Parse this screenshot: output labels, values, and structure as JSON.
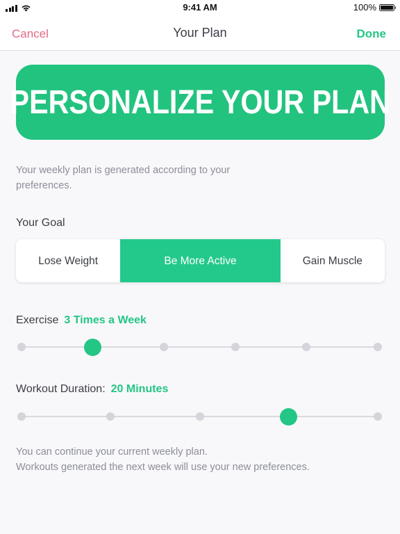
{
  "status_bar": {
    "time": "9:41 AM",
    "battery": "100%",
    "icons": [
      "signal-icon",
      "wifi-icon",
      "battery-icon"
    ]
  },
  "nav": {
    "cancel": "Cancel",
    "title": "Your Plan",
    "done": "Done"
  },
  "banner": {
    "text": "PERSONALIZE YOUR PLAN"
  },
  "intro": "Your weekly plan is generated according to your preferences.",
  "goal": {
    "label": "Your Goal",
    "options": [
      "Lose Weight",
      "Be More Active",
      "Gain Muscle"
    ],
    "selected_index": 1
  },
  "exercise": {
    "label": "Exercise",
    "value": "3 Times a Week",
    "stops": 6,
    "selected_index": 1
  },
  "duration": {
    "label": "Workout Duration:",
    "value": "20 Minutes",
    "stops": 5,
    "selected_index": 3
  },
  "footer": {
    "line1": "You can continue your current weekly plan.",
    "line2": "Workouts generated the next week will use your new preferences."
  },
  "colors": {
    "accent": "#23c684",
    "cancel": "#e46a85",
    "banner": "#22c37f"
  }
}
